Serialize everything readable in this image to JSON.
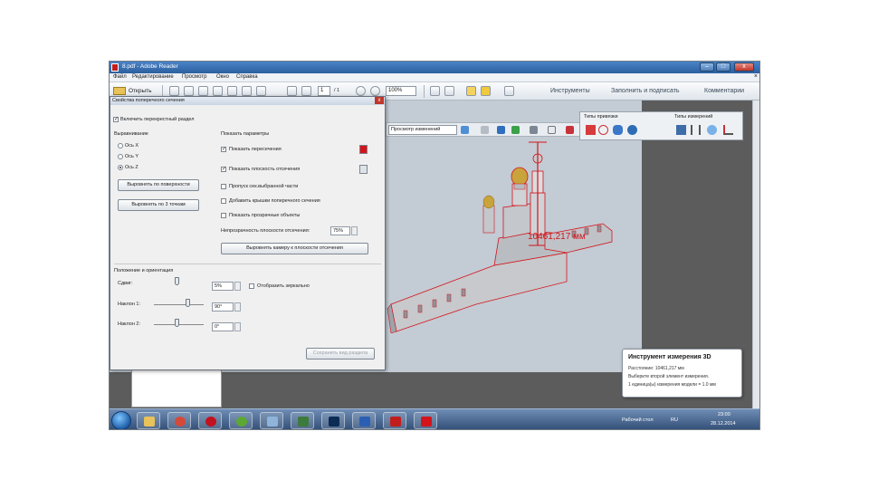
{
  "window": {
    "title": "8.pdf - Adobe Reader",
    "minimize": "–",
    "maximize": "□",
    "close": "x"
  },
  "menu": {
    "items": [
      "Файл",
      "Редактирование",
      "Просмотр",
      "Окно",
      "Справка"
    ],
    "close": "×"
  },
  "toolbar": {
    "open_label": "Открыть",
    "page_number": "1",
    "page_total": "/ 1",
    "zoom": "100%",
    "links": [
      "Инструменты",
      "Заполнить и подписать",
      "Комментарии"
    ]
  },
  "toolbar3d": {
    "view_select": "Просмотр изменений"
  },
  "measure_panel": {
    "snap_types_title": "Типы привязки",
    "measure_types_title": "Типы измерений"
  },
  "model": {
    "dimension_label": "10461,217 мм"
  },
  "info_box": {
    "title": "Инструмент измерения 3D",
    "line1": "Расстояние: 10461,217 мм",
    "line2": "Выберите второй элемент измерения.",
    "line3": "1 единица(ы) измерения модели = 1.0 мм"
  },
  "dialog": {
    "title": "Свойства поперечного сечения",
    "enable_label": "Включить перекрестный раздел",
    "align_title": "Выравнивание",
    "axis_x": "Ось X",
    "axis_y": "Ось Y",
    "axis_z": "Ось Z",
    "align_surface_btn": "Выровнять по поверхности",
    "align_3pts_btn": "Выровнять по 3 точкам",
    "display_title": "Показать параметры",
    "show_intersections": "Показать пересечения",
    "show_plane": "Показать плоскость отсечения",
    "ignore_selected": "Пропуск сек.выбранной части",
    "add_caps": "Добавить крышки поперечного сечения",
    "show_transparent": "Показать прозрачные объекты",
    "opacity_label": "Непрозрачность плоскости отсечения:",
    "opacity_value": "75%",
    "align_camera_btn": "Выровнять камеру к плоскости отсечения",
    "position_title": "Положение и ориентация",
    "offset_label": "Сдвиг:",
    "offset_value": "5%",
    "flip_label": "Отобразить зеркально",
    "tilt1_label": "Наклон 1:",
    "tilt1_value": "90°",
    "tilt2_label": "Наклон 2:",
    "tilt2_value": "0°",
    "save_view_btn": "Сохранить вид раздела",
    "close": "x"
  },
  "taskbar": {
    "desktop_label": "Рабочий стол",
    "language": "RU",
    "time": "23:00",
    "date": "28.12.2014"
  },
  "colors": {
    "accent_red": "#d3141b",
    "titlebar": "#2c5f9e",
    "dialog_bg": "#f0f0f0",
    "viewport_bg": "#c3cbd4"
  }
}
